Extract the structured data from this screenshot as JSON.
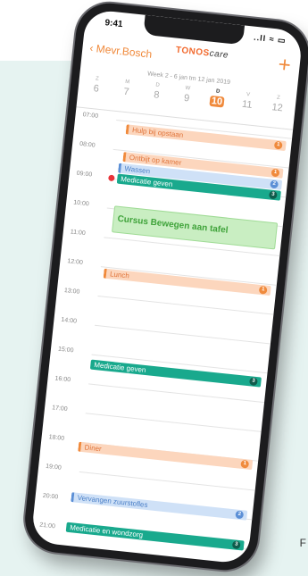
{
  "status_bar": {
    "time": "9:41",
    "icons": "..ll ≈ ▭"
  },
  "navbar": {
    "back_label": "Mevr.Bosch",
    "brand_part1": "TONOS",
    "brand_part2": "care",
    "add_label": "+"
  },
  "week": {
    "title": "Week 2 - 6 jan tm 12 jan 2019",
    "days": [
      {
        "letter": "Z",
        "num": "6"
      },
      {
        "letter": "M",
        "num": "7"
      },
      {
        "letter": "D",
        "num": "8"
      },
      {
        "letter": "W",
        "num": "9"
      },
      {
        "letter": "D",
        "num": "10",
        "active": true
      },
      {
        "letter": "V",
        "num": "11"
      },
      {
        "letter": "Z",
        "num": "12"
      }
    ]
  },
  "hours": [
    "07:00",
    "08:00",
    "09:00",
    "10:00",
    "11:00",
    "12:00",
    "13:00",
    "14:00",
    "15:00",
    "16:00",
    "17:00",
    "18:00",
    "19:00",
    "20:00",
    "21:00"
  ],
  "events": [
    {
      "label": "Hulp bij opstaan",
      "color": "orange",
      "badge": "1"
    },
    {
      "label": "Ontbijt op kamer",
      "color": "orange",
      "badge": "1"
    },
    {
      "label": "Wassen",
      "color": "blue",
      "badge": "2"
    },
    {
      "label": "Medicatie geven",
      "color": "teal",
      "badge": "3"
    },
    {
      "label": "Cursus Bewegen aan tafel",
      "color": "green",
      "badge": ""
    },
    {
      "label": "Lunch",
      "color": "orange",
      "badge": "1"
    },
    {
      "label": "Medicatie geven",
      "color": "teal",
      "badge": "3"
    },
    {
      "label": "Diner",
      "color": "orange",
      "badge": "1"
    },
    {
      "label": "Vervangen zuurstofles",
      "color": "blue",
      "badge": "2"
    },
    {
      "label": "Medicatie en wondzorg",
      "color": "teal",
      "badge": "3"
    }
  ],
  "edge_letter": "F",
  "colors": {
    "accent": "#f08a3c",
    "teal": "#19a98d",
    "blue": "#5b8fd6",
    "green": "#9fdb95",
    "background": "#e6f3f1"
  }
}
